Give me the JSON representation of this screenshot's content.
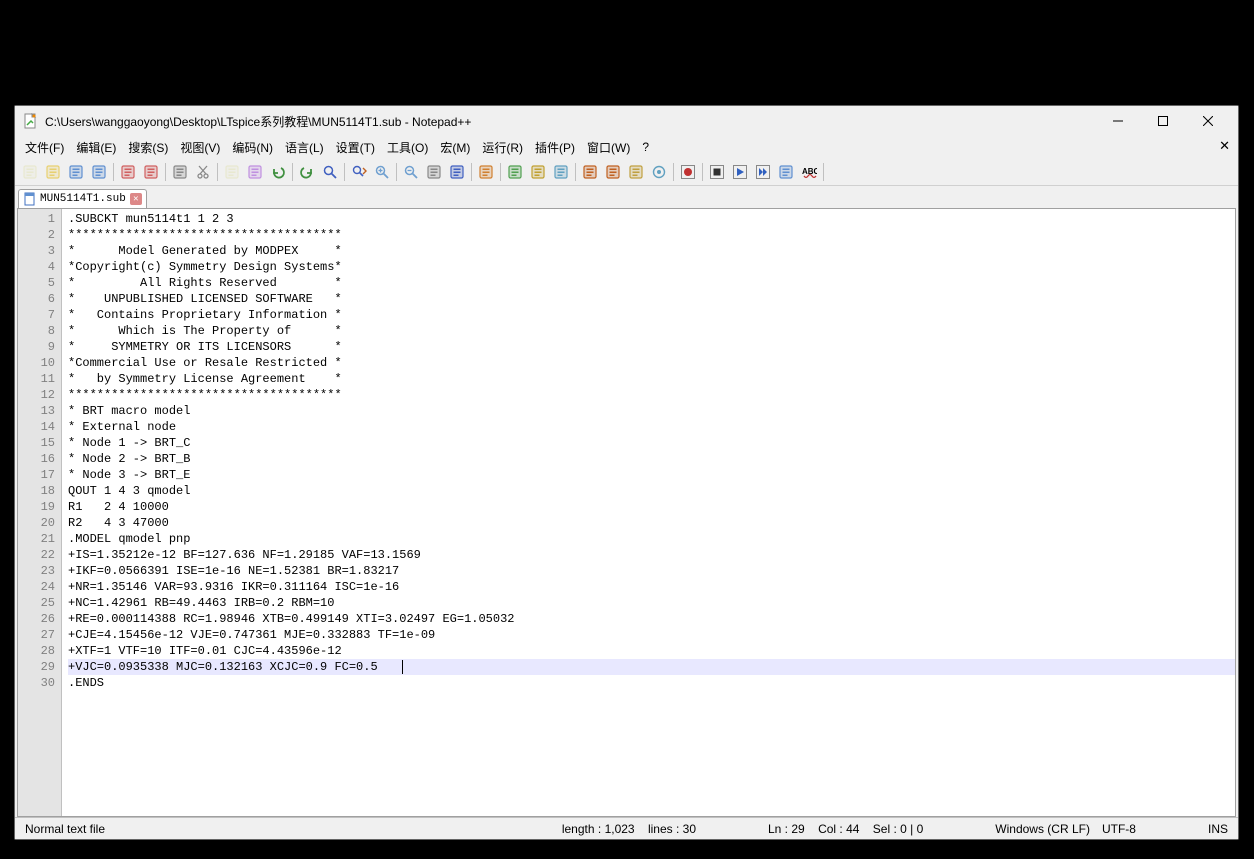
{
  "window": {
    "title": "C:\\Users\\wanggaoyong\\Desktop\\LTspice系列教程\\MUN5114T1.sub - Notepad++"
  },
  "menubar": {
    "items": [
      "文件(F)",
      "编辑(E)",
      "搜索(S)",
      "视图(V)",
      "编码(N)",
      "语言(L)",
      "设置(T)",
      "工具(O)",
      "宏(M)",
      "运行(R)",
      "插件(P)",
      "窗口(W)",
      "?"
    ]
  },
  "toolbar_icons": [
    "new",
    "open",
    "save",
    "save-all",
    "close",
    "close-all",
    "print",
    "cut",
    "copy",
    "paste",
    "undo",
    "redo",
    "find",
    "replace",
    "zoom-in",
    "zoom-out",
    "sync",
    "wrap",
    "all-chars",
    "indent-guide",
    "lang",
    "doc-map",
    "doc-list",
    "func-list",
    "folder",
    "monitor",
    "macro-record",
    "macro-stop",
    "macro-play",
    "macro-play-multi",
    "macro-save",
    "spell-check"
  ],
  "tab": {
    "filename": "MUN5114T1.sub"
  },
  "editor": {
    "current_line_index": 28,
    "lines": [
      ".SUBCKT mun5114t1 1 2 3",
      "**************************************",
      "*      Model Generated by MODPEX     *",
      "*Copyright(c) Symmetry Design Systems*",
      "*         All Rights Reserved        *",
      "*    UNPUBLISHED LICENSED SOFTWARE   *",
      "*   Contains Proprietary Information *",
      "*      Which is The Property of      *",
      "*     SYMMETRY OR ITS LICENSORS      *",
      "*Commercial Use or Resale Restricted *",
      "*   by Symmetry License Agreement    *",
      "**************************************",
      "* BRT macro model",
      "* External node",
      "* Node 1 -> BRT_C",
      "* Node 2 -> BRT_B",
      "* Node 3 -> BRT_E",
      "QOUT 1 4 3 qmodel",
      "R1   2 4 10000",
      "R2   4 3 47000",
      ".MODEL qmodel pnp",
      "+IS=1.35212e-12 BF=127.636 NF=1.29185 VAF=13.1569",
      "+IKF=0.0566391 ISE=1e-16 NE=1.52381 BR=1.83217",
      "+NR=1.35146 VAR=93.9316 IKR=0.311164 ISC=1e-16",
      "+NC=1.42961 RB=49.4463 IRB=0.2 RBM=10",
      "+RE=0.000114388 RC=1.98946 XTB=0.499149 XTI=3.02497 EG=1.05032",
      "+CJE=4.15456e-12 VJE=0.747361 MJE=0.332883 TF=1e-09",
      "+XTF=1 VTF=10 ITF=0.01 CJC=4.43596e-12",
      "+VJC=0.0935338 MJC=0.132163 XCJC=0.9 FC=0.5",
      ".ENDS"
    ]
  },
  "statusbar": {
    "file_type": "Normal text file",
    "length_label": "length :",
    "length_value": "1,023",
    "lines_label": "lines :",
    "lines_value": "30",
    "ln_label": "Ln :",
    "ln_value": "29",
    "col_label": "Col :",
    "col_value": "44",
    "sel_label": "Sel :",
    "sel_value": "0 | 0",
    "eol": "Windows (CR LF)",
    "encoding": "UTF-8",
    "mode": "INS"
  },
  "icon_colors": {
    "new": "#e8e8d0",
    "open": "#e8d070",
    "save": "#6090d0",
    "save-all": "#6090d0",
    "close": "#d06060",
    "close-all": "#d06060",
    "print": "#888",
    "cut": "#888",
    "copy": "#e8e8d0",
    "paste": "#c090e0",
    "undo": "#409040",
    "redo": "#409040",
    "find": "#4060c0",
    "replace": "#4060c0",
    "zoom-in": "#70a0d0",
    "zoom-out": "#70a0d0",
    "sync": "#888",
    "wrap": "#4060c0",
    "all-chars": "#d08030",
    "indent-guide": "#50a050",
    "lang": "#c0a030",
    "doc-map": "#60a0c0",
    "doc-list": "#c06020",
    "func-list": "#c06020",
    "folder": "#c0a040",
    "monitor": "#60a0c0",
    "macro-record": "#c03030",
    "macro-stop": "#303030",
    "macro-play": "#3060c0",
    "macro-play-multi": "#3060c0",
    "macro-save": "#6090d0",
    "spell-check": "#c03030"
  }
}
